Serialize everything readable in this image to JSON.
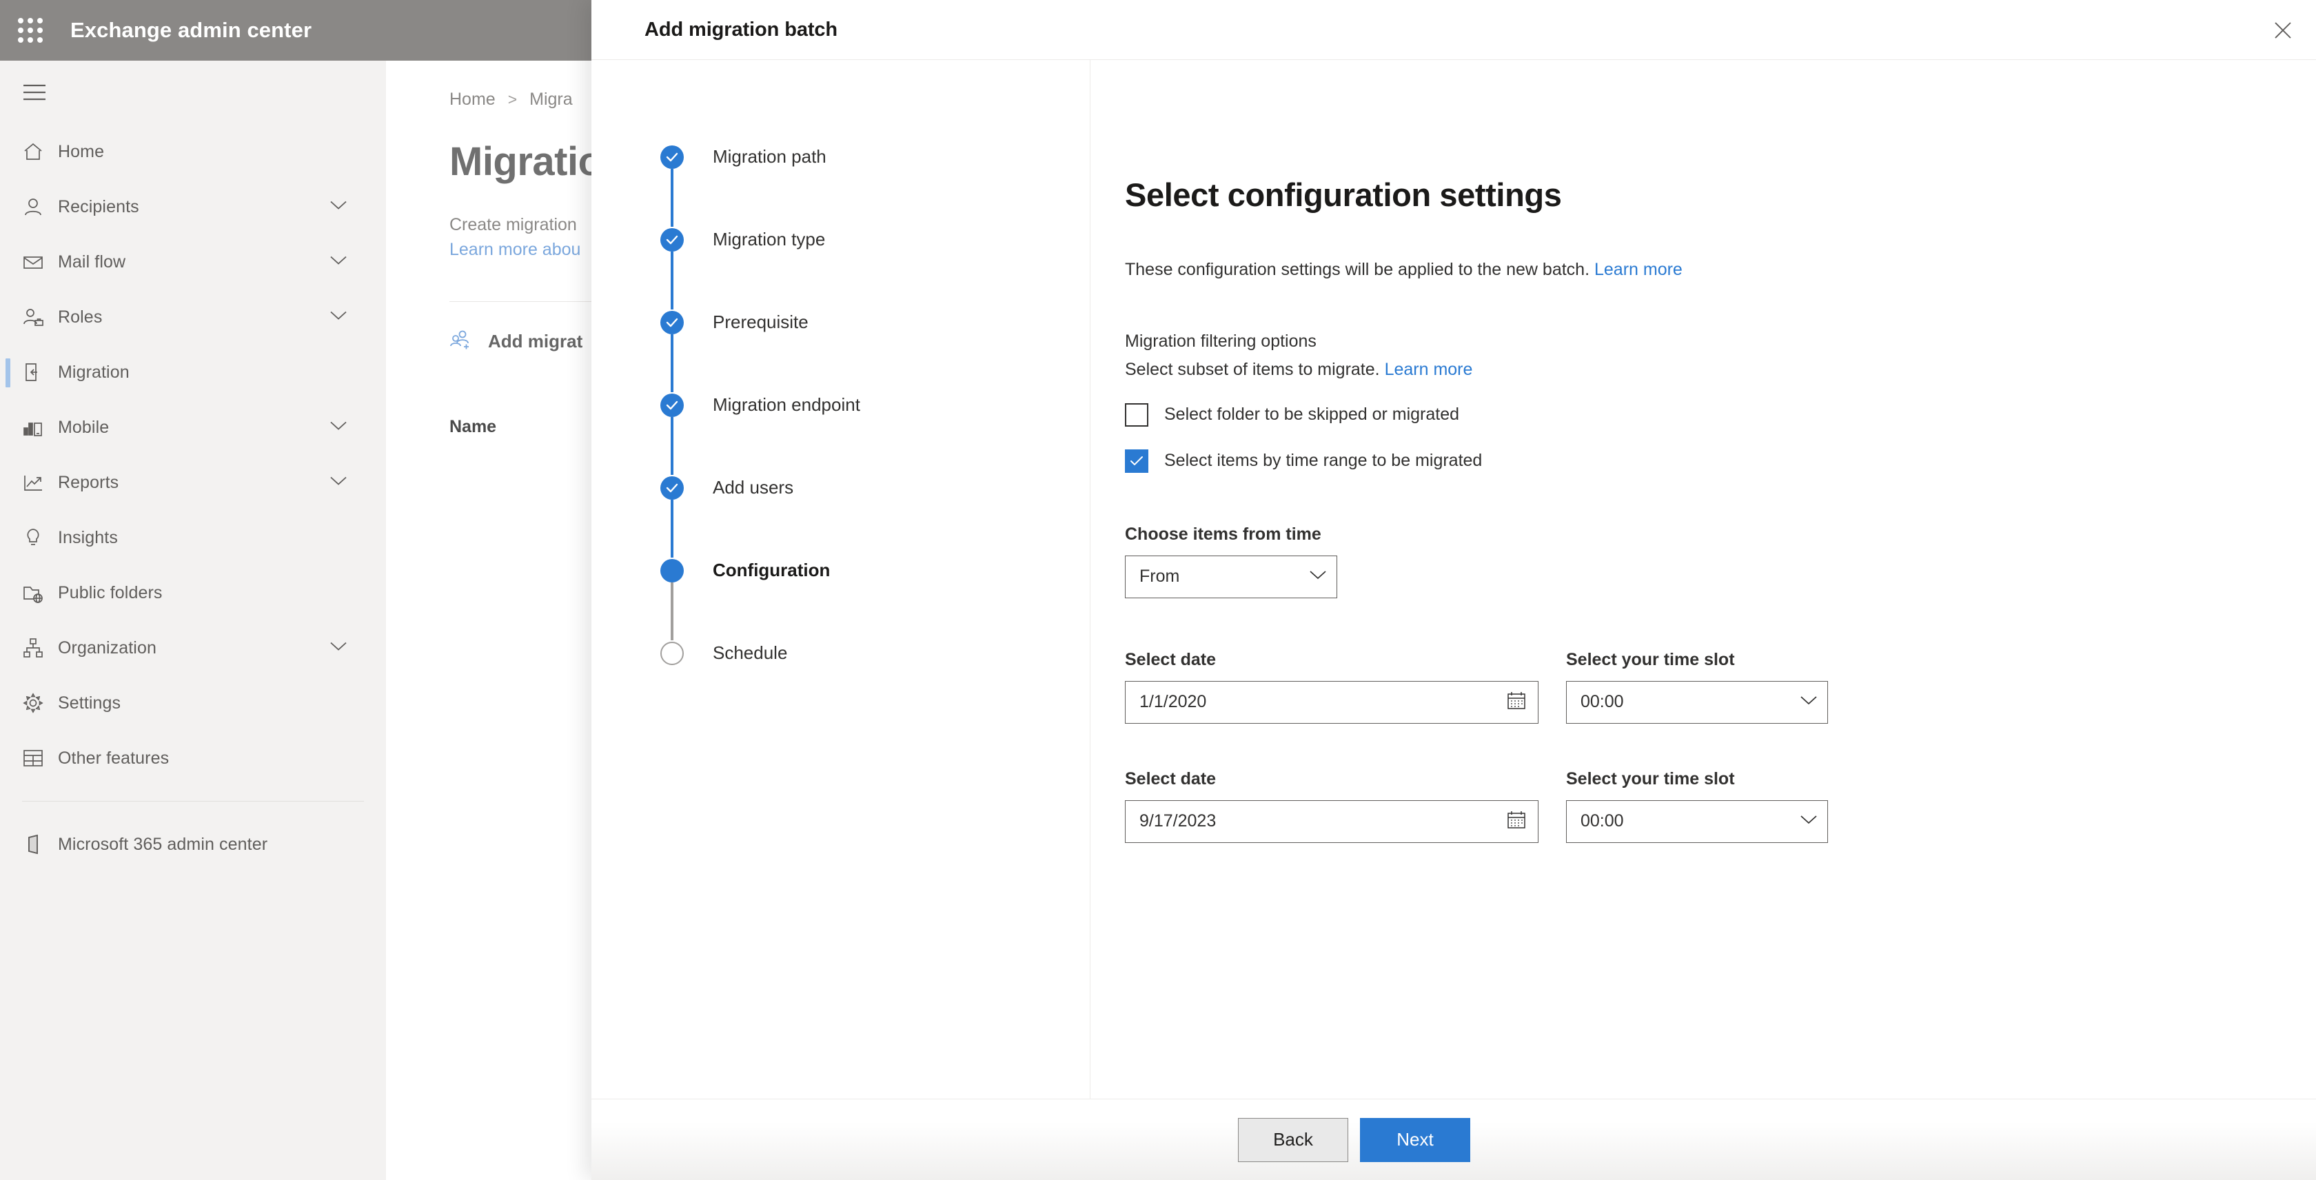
{
  "suite": {
    "app_title": "Exchange admin center",
    "waffle_icon": "app-launcher-icon",
    "bar_color": "#8a8886"
  },
  "sidebar": {
    "hamburger_icon": "hamburger-menu-icon",
    "items": [
      {
        "label": "Home",
        "icon": "home-icon",
        "expandable": false,
        "selected": false
      },
      {
        "label": "Recipients",
        "icon": "person-icon",
        "expandable": true,
        "selected": false
      },
      {
        "label": "Mail flow",
        "icon": "envelope-icon",
        "expandable": true,
        "selected": false
      },
      {
        "label": "Roles",
        "icon": "person-briefcase-icon",
        "expandable": true,
        "selected": false
      },
      {
        "label": "Migration",
        "icon": "migration-icon",
        "expandable": false,
        "selected": true
      },
      {
        "label": "Mobile",
        "icon": "mobile-chart-icon",
        "expandable": true,
        "selected": false
      },
      {
        "label": "Reports",
        "icon": "report-trend-icon",
        "expandable": true,
        "selected": false
      },
      {
        "label": "Insights",
        "icon": "lightbulb-icon",
        "expandable": false,
        "selected": false
      },
      {
        "label": "Public folders",
        "icon": "public-folder-icon",
        "expandable": false,
        "selected": false
      },
      {
        "label": "Organization",
        "icon": "org-hierarchy-icon",
        "expandable": true,
        "selected": false
      },
      {
        "label": "Settings",
        "icon": "gear-icon",
        "expandable": false,
        "selected": false
      },
      {
        "label": "Other features",
        "icon": "table-grid-icon",
        "expandable": false,
        "selected": false
      }
    ],
    "footer_item": {
      "label": "Microsoft 365 admin center",
      "icon": "office-cube-icon"
    }
  },
  "page": {
    "breadcrumb": {
      "home": "Home",
      "separator": ">",
      "current": "Migra"
    },
    "title": "Migratio",
    "description_line1": "Create migration",
    "description_line2": "Learn more abou",
    "command_add": "Add migrat",
    "command_add_icon": "add-users-icon",
    "list_column_name": "Name"
  },
  "modal": {
    "title": "Add migration batch",
    "close_icon": "close-icon",
    "steps": [
      {
        "label": "Migration path",
        "state": "complete"
      },
      {
        "label": "Migration type",
        "state": "complete"
      },
      {
        "label": "Prerequisite",
        "state": "complete"
      },
      {
        "label": "Migration endpoint",
        "state": "complete"
      },
      {
        "label": "Add users",
        "state": "complete"
      },
      {
        "label": "Configuration",
        "state": "current"
      },
      {
        "label": "Schedule",
        "state": "upcoming"
      }
    ],
    "content": {
      "heading": "Select configuration settings",
      "intro_text": "These configuration settings will be applied to the new batch.",
      "intro_link": "Learn more",
      "filter_section_title": "Migration filtering options",
      "filter_section_sub": "Select subset of items to migrate.",
      "filter_section_link": "Learn more",
      "checkbox_folder": {
        "label": "Select folder to be skipped or migrated",
        "checked": false
      },
      "checkbox_timerange": {
        "label": "Select items by time range to be migrated",
        "checked": true
      },
      "choose_time_label": "Choose items from time",
      "choose_time_value": "From",
      "date_rows": [
        {
          "date_label": "Select date",
          "date_value": "1/1/2020",
          "date_icon": "calendar-icon",
          "time_label": "Select your time slot",
          "time_value": "00:00"
        },
        {
          "date_label": "Select date",
          "date_value": "9/17/2023",
          "date_icon": "calendar-icon",
          "time_label": "Select your time slot",
          "time_value": "00:00"
        }
      ]
    },
    "footer": {
      "back_label": "Back",
      "next_label": "Next"
    }
  },
  "colors": {
    "accent": "#2a7ad2",
    "link": "#2a7ad2",
    "nav_bg": "#f3f2f1",
    "suite_bar": "#8a8886",
    "text_primary": "#323130"
  }
}
